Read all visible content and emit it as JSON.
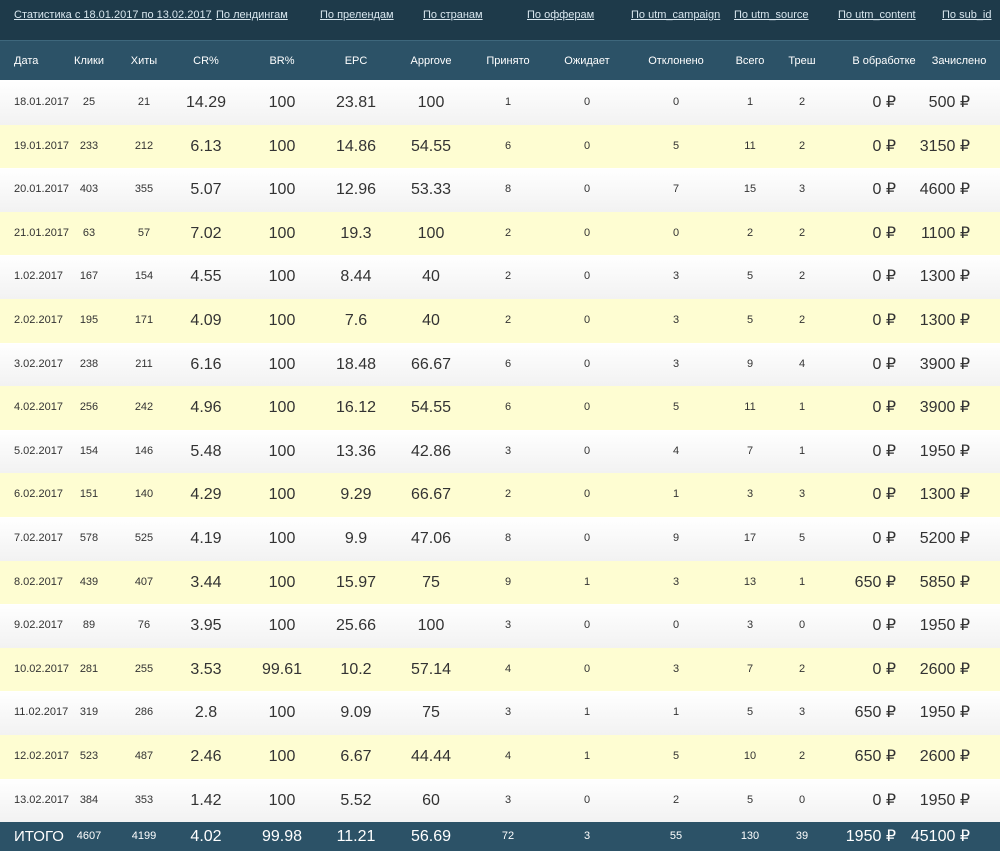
{
  "nav": {
    "period": "Статистика с 18.01.2017 по 13.02.2017",
    "links": [
      "По лендингам",
      "По прелендам",
      "По странам",
      "По офферам",
      "По utm_campaign",
      "По utm_source",
      "По utm_content",
      "По sub_id"
    ]
  },
  "columns": [
    "Дата",
    "Клики",
    "Хиты",
    "CR%",
    "BR%",
    "EPC",
    "Approve",
    "Принято",
    "Ожидает",
    "Отклонено",
    "Всего",
    "Треш",
    "В обработке",
    "Зачислено"
  ],
  "rows": [
    [
      "18.01.2017",
      "25",
      "21",
      "14.29",
      "100",
      "23.81",
      "100",
      "1",
      "0",
      "0",
      "1",
      "2",
      "0 ₽",
      "500 ₽"
    ],
    [
      "19.01.2017",
      "233",
      "212",
      "6.13",
      "100",
      "14.86",
      "54.55",
      "6",
      "0",
      "5",
      "11",
      "2",
      "0 ₽",
      "3150 ₽"
    ],
    [
      "20.01.2017",
      "403",
      "355",
      "5.07",
      "100",
      "12.96",
      "53.33",
      "8",
      "0",
      "7",
      "15",
      "3",
      "0 ₽",
      "4600 ₽"
    ],
    [
      "21.01.2017",
      "63",
      "57",
      "7.02",
      "100",
      "19.3",
      "100",
      "2",
      "0",
      "0",
      "2",
      "2",
      "0 ₽",
      "1100 ₽"
    ],
    [
      "1.02.2017",
      "167",
      "154",
      "4.55",
      "100",
      "8.44",
      "40",
      "2",
      "0",
      "3",
      "5",
      "2",
      "0 ₽",
      "1300 ₽"
    ],
    [
      "2.02.2017",
      "195",
      "171",
      "4.09",
      "100",
      "7.6",
      "40",
      "2",
      "0",
      "3",
      "5",
      "2",
      "0 ₽",
      "1300 ₽"
    ],
    [
      "3.02.2017",
      "238",
      "211",
      "6.16",
      "100",
      "18.48",
      "66.67",
      "6",
      "0",
      "3",
      "9",
      "4",
      "0 ₽",
      "3900 ₽"
    ],
    [
      "4.02.2017",
      "256",
      "242",
      "4.96",
      "100",
      "16.12",
      "54.55",
      "6",
      "0",
      "5",
      "11",
      "1",
      "0 ₽",
      "3900 ₽"
    ],
    [
      "5.02.2017",
      "154",
      "146",
      "5.48",
      "100",
      "13.36",
      "42.86",
      "3",
      "0",
      "4",
      "7",
      "1",
      "0 ₽",
      "1950 ₽"
    ],
    [
      "6.02.2017",
      "151",
      "140",
      "4.29",
      "100",
      "9.29",
      "66.67",
      "2",
      "0",
      "1",
      "3",
      "3",
      "0 ₽",
      "1300 ₽"
    ],
    [
      "7.02.2017",
      "578",
      "525",
      "4.19",
      "100",
      "9.9",
      "47.06",
      "8",
      "0",
      "9",
      "17",
      "5",
      "0 ₽",
      "5200 ₽"
    ],
    [
      "8.02.2017",
      "439",
      "407",
      "3.44",
      "100",
      "15.97",
      "75",
      "9",
      "1",
      "3",
      "13",
      "1",
      "650 ₽",
      "5850 ₽"
    ],
    [
      "9.02.2017",
      "89",
      "76",
      "3.95",
      "100",
      "25.66",
      "100",
      "3",
      "0",
      "0",
      "3",
      "0",
      "0 ₽",
      "1950 ₽"
    ],
    [
      "10.02.2017",
      "281",
      "255",
      "3.53",
      "99.61",
      "10.2",
      "57.14",
      "4",
      "0",
      "3",
      "7",
      "2",
      "0 ₽",
      "2600 ₽"
    ],
    [
      "11.02.2017",
      "319",
      "286",
      "2.8",
      "100",
      "9.09",
      "75",
      "3",
      "1",
      "1",
      "5",
      "3",
      "650 ₽",
      "1950 ₽"
    ],
    [
      "12.02.2017",
      "523",
      "487",
      "2.46",
      "100",
      "6.67",
      "44.44",
      "4",
      "1",
      "5",
      "10",
      "2",
      "650 ₽",
      "2600 ₽"
    ],
    [
      "13.02.2017",
      "384",
      "353",
      "1.42",
      "100",
      "5.52",
      "60",
      "3",
      "0",
      "2",
      "5",
      "0",
      "0 ₽",
      "1950 ₽"
    ]
  ],
  "total": [
    "ИТОГО",
    "4607",
    "4199",
    "4.02",
    "99.98",
    "11.21",
    "56.69",
    "72",
    "3",
    "55",
    "130",
    "39",
    "1950 ₽",
    "45100 ₽"
  ],
  "colors": {
    "nav_bg": "#1e3a4a",
    "header_bg": "#2c5267",
    "row_yellow": "#fefdd2"
  }
}
